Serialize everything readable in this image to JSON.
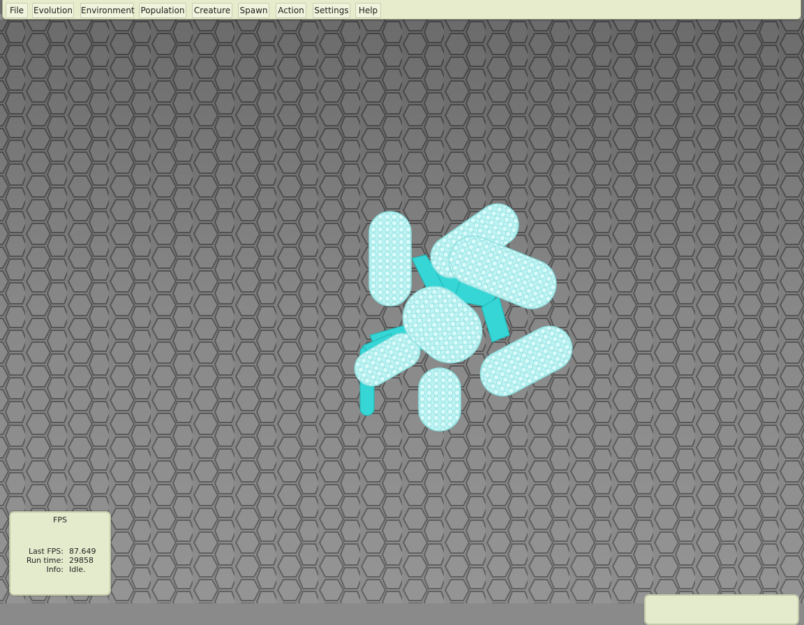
{
  "menubar": {
    "items": [
      {
        "label": "File"
      },
      {
        "label": "Evolution"
      },
      {
        "label": "Environment"
      },
      {
        "label": "Population"
      },
      {
        "label": "Creature"
      },
      {
        "label": "Spawn"
      },
      {
        "label": "Action"
      },
      {
        "label": "Settings"
      },
      {
        "label": "Help"
      }
    ]
  },
  "fps_panel": {
    "title": "FPS",
    "rows": [
      {
        "label": "Last FPS:",
        "value": "87.649"
      },
      {
        "label": "Run time:",
        "value": "29858"
      },
      {
        "label": "Info:",
        "value": "Idle."
      }
    ]
  },
  "scene": {
    "creature_color": "#5fe6e6",
    "floor_color": "#8c8c8c",
    "panel_color": "#e3ebcc"
  }
}
